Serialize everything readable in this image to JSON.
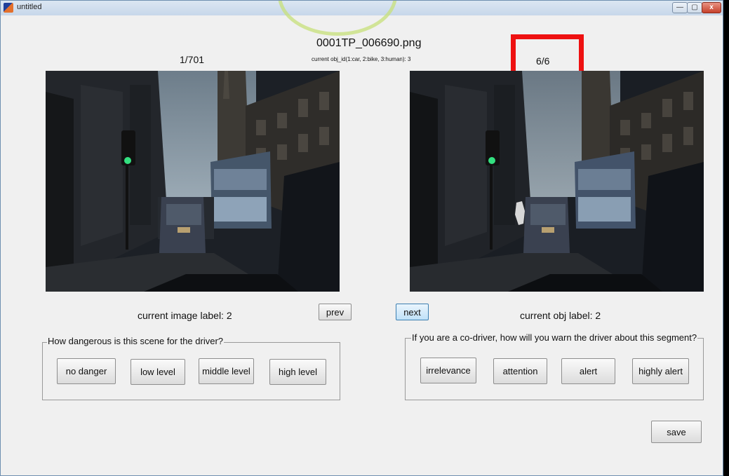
{
  "window": {
    "title": "untitled",
    "minimize_glyph": "—",
    "maximize_glyph": "▢",
    "close_glyph": "x"
  },
  "header": {
    "filename": "0001TP_006690.png",
    "image_counter": "1/701",
    "obj_id_prompt": "current obj_id(1:car, 2:bike, 3:human): 3",
    "obj_counter": "6/6"
  },
  "labels": {
    "current_image_label": "current image label: 2",
    "current_obj_label": "current obj label: 2"
  },
  "nav": {
    "prev": "prev",
    "next": "next"
  },
  "danger_group": {
    "title": "How dangerous is this scene for the driver?",
    "buttons": [
      "no danger",
      "low level",
      "middle level",
      "high level"
    ]
  },
  "warn_group": {
    "title": "If you are a co-driver, how will you warn the driver about this segment?",
    "buttons": [
      "irrelevance",
      "attention",
      "alert",
      "highly alert"
    ]
  },
  "save": "save",
  "colors": {
    "highlight": "#ee1111",
    "next_accent": "#3c7fb1"
  }
}
